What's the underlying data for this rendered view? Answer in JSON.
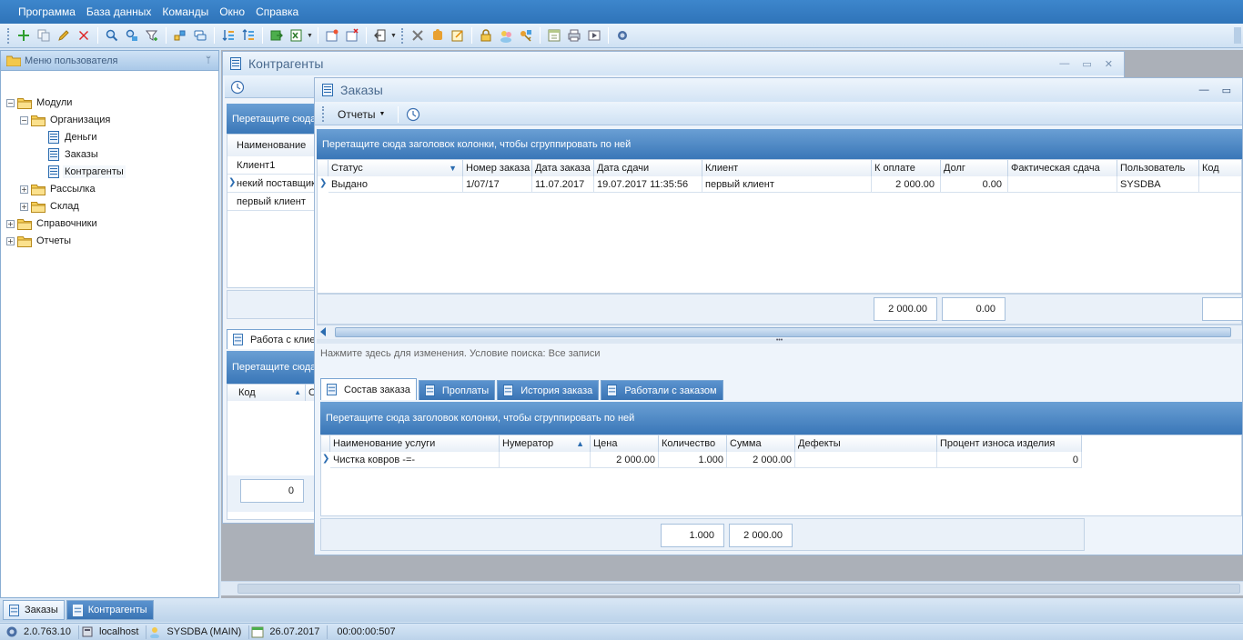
{
  "menu": [
    "Программа",
    "База данных",
    "Команды",
    "Окно",
    "Справка"
  ],
  "toolbar": {
    "icons": [
      "add-icon",
      "copy-icon",
      "edit-icon",
      "delete-icon",
      "find-icon",
      "find-replace-icon",
      "filter-icon",
      "tree-expand-icon",
      "comments-icon",
      "sort-asc-icon",
      "sort-desc-icon",
      "export-icon",
      "export-excel-icon",
      "new-window-icon",
      "close-window-icon",
      "exit-icon",
      "tools-icon",
      "puzzle-icon",
      "notes-icon",
      "lock-icon",
      "users-icon",
      "key-icon",
      "calendar-icon",
      "print-icon",
      "play-icon",
      "info-icon"
    ]
  },
  "sidebar": {
    "title": "Меню пользователя",
    "tree": [
      {
        "label": "Модули",
        "level": 0,
        "expander": "−",
        "type": "folder"
      },
      {
        "label": "Организация",
        "level": 1,
        "expander": "−",
        "type": "folder"
      },
      {
        "label": "Деньги",
        "level": 2,
        "expander": "",
        "type": "doc"
      },
      {
        "label": "Заказы",
        "level": 2,
        "expander": "",
        "type": "doc"
      },
      {
        "label": "Контрагенты",
        "level": 2,
        "expander": "",
        "type": "doc",
        "selected": true
      },
      {
        "label": "Рассылка",
        "level": 1,
        "expander": "+",
        "type": "folder"
      },
      {
        "label": "Склад",
        "level": 1,
        "expander": "+",
        "type": "folder"
      },
      {
        "label": "Справочники",
        "level": 0,
        "expander": "+",
        "type": "folder"
      },
      {
        "label": "Отчеты",
        "level": 0,
        "expander": "+",
        "type": "folder"
      }
    ]
  },
  "kontr": {
    "title": "Контрагенты",
    "groupbar": "Перетащите сюда",
    "column": "Наименование",
    "rows": [
      "Клиент1",
      "некий поставщик",
      "первый клиент"
    ],
    "tab": "Работа с клиентом",
    "groupbar2": "Перетащите сюда",
    "col2a": "Код",
    "col2b": "С",
    "footer": "0"
  },
  "zakazy": {
    "title": "Заказы",
    "reports": "Отчеты",
    "groupbar": "Перетащите сюда заголовок колонки, чтобы сгруппировать по ней",
    "columns": [
      "Статус",
      "Номер заказа",
      "Дата заказа",
      "Дата сдачи",
      "Клиент",
      "К оплате",
      "Долг",
      "Фактическая сдача",
      "Пользователь",
      "Код"
    ],
    "row": [
      "Выдано",
      "1/07/17",
      "11.07.2017",
      "19.07.2017 11:35:56",
      "первый клиент",
      "2 000.00",
      "0.00",
      "",
      "SYSDBA",
      ""
    ],
    "footer": [
      "2 000.00",
      "0.00"
    ],
    "filter_text": "Нажмите здесь для изменения. Условие поиска: Все записи",
    "tabs": [
      "Состав заказа",
      "Проплаты",
      "История заказа",
      "Работали с заказом"
    ],
    "detail_groupbar": "Перетащите сюда заголовок колонки, чтобы сгруппировать по ней",
    "detail_columns": [
      "Наименование услуги",
      "Нумератор",
      "Цена",
      "Количество",
      "Сумма",
      "Дефекты",
      "Процент износа изделия"
    ],
    "detail_row": [
      "Чистка ковров -=-",
      "",
      "2 000.00",
      "1.000",
      "2 000.00",
      "",
      "0"
    ],
    "detail_footer": [
      "1.000",
      "2 000.00"
    ]
  },
  "taskbar": [
    "Заказы",
    "Контрагенты"
  ],
  "status": {
    "version": "2.0.763.10",
    "host": "localhost",
    "user": "SYSDBA (MAIN)",
    "date": "26.07.2017",
    "time": "00:00:00:507"
  }
}
